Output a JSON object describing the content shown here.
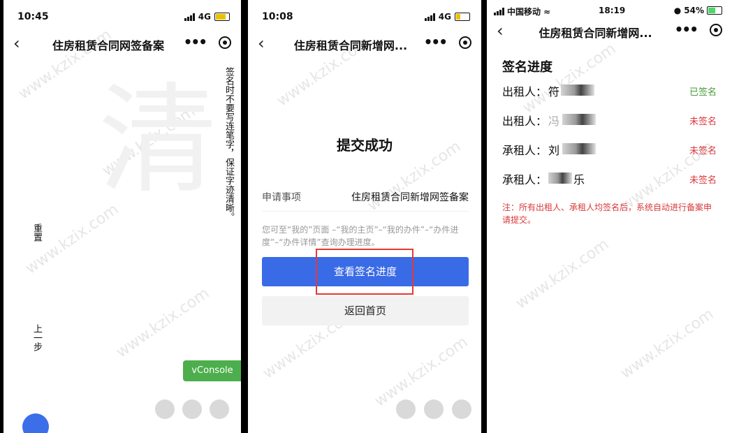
{
  "panel1": {
    "time": "10:45",
    "network": "4G",
    "title": "住房租赁合同网签备案",
    "vertical_hint": "签名时不要写连笔字，保证字迹清晰。",
    "reset_label": "重置",
    "prev_label": "上一步",
    "vconsole_label": "vConsole"
  },
  "panel2": {
    "time": "10:08",
    "network": "4G",
    "title": "住房租赁合同新增网...",
    "success_text": "提交成功",
    "item_label": "申请事项",
    "item_value": "住房租赁合同新增网签备案",
    "hint_text": "您可至“我的”页面 –“我的主页”–“我的办件”–“办件进度”–“办件详情”查询办理进度。",
    "primary_button": "查看签名进度",
    "secondary_button": "返回首页"
  },
  "panel3": {
    "carrier": "中国移动",
    "time": "18:19",
    "battery": "54%",
    "title": "住房租赁合同新增网...",
    "section_title": "签名进度",
    "signers": [
      {
        "role": "出租人：",
        "name_visible": "符",
        "name_suffix": "",
        "status": "已签名",
        "status_color": "#4a9a3a"
      },
      {
        "role": "出租人：",
        "name_visible": "冯",
        "name_suffix": "",
        "status": "未签名",
        "status_color": "#d9393b"
      },
      {
        "role": "承租人：",
        "name_visible": "刘",
        "name_suffix": "",
        "status": "未签名",
        "status_color": "#d9393b"
      },
      {
        "role": "承租人：",
        "name_visible": "",
        "name_suffix": "乐",
        "status": "未签名",
        "status_color": "#d9393b"
      }
    ],
    "note": "注：所有出租人、承租人均签名后，系统自动进行备案申请提交。"
  },
  "nav_back_icon": "back-chevron-icon",
  "more_icon": "more-dots-icon",
  "close_icon": "target-circle-icon",
  "watermark_text": "www.kzix.com",
  "accent_color": "#3a6be6"
}
